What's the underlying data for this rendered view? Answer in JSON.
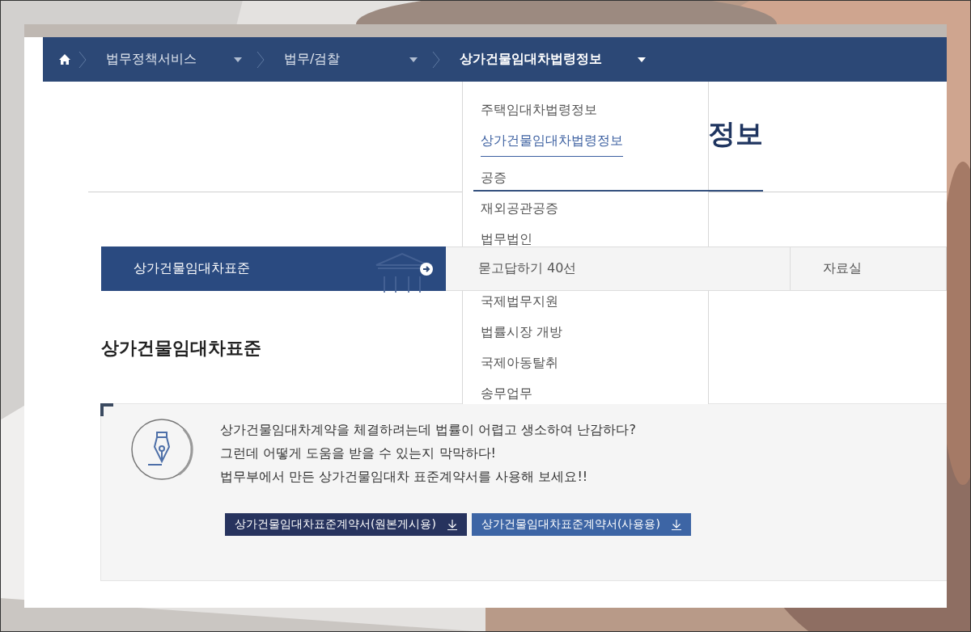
{
  "breadcrumb": [
    {
      "label": "법무정책서비스",
      "current": false
    },
    {
      "label": "법무/검찰",
      "current": false
    },
    {
      "label": "상가건물임대차법령정보",
      "current": true
    }
  ],
  "dropdown": {
    "items": [
      {
        "label": "주택임대차법령정보",
        "selected": false
      },
      {
        "label": "상가건물임대차법령정보",
        "selected": true
      },
      {
        "label": "공증",
        "selected": false
      },
      {
        "label": "재외공관공증",
        "selected": false
      },
      {
        "label": "법무법인",
        "selected": false
      },
      {
        "label": "국제법무지원",
        "selected": false
      },
      {
        "label": "법률시장 개방",
        "selected": false
      },
      {
        "label": "국제아동탈취",
        "selected": false
      },
      {
        "label": "송무업무",
        "selected": false
      }
    ]
  },
  "page_title": "정보",
  "tabs": [
    {
      "label": "상가건물임대차표준",
      "selected": true
    },
    {
      "label": "묻고답하기 40선",
      "selected": false
    },
    {
      "label": "자료실",
      "selected": false
    }
  ],
  "section_heading": "상가건물임대차표준",
  "info_box": {
    "lines": [
      "상가건물임대차계약을 체결하려는데 법률이 어렵고 생소하여 난감하다?",
      "그런데 어떻게 도움을 받을 수 있는지 막막하다!",
      "법무부에서 만든 상가건물임대차 표준계약서를 사용해 보세요!!"
    ],
    "buttons": [
      {
        "label": "상가건물임대차표준계약서(원본게시용)",
        "kind": "dark"
      },
      {
        "label": "상가건물임대차표준계약서(사용용)",
        "kind": "light"
      }
    ]
  }
}
